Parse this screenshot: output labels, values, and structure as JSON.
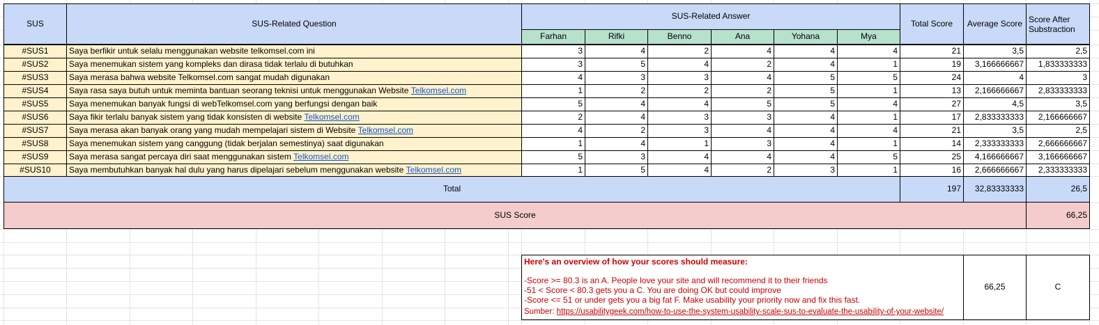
{
  "header": {
    "sus": "SUS",
    "question": "SUS-Related Question",
    "answer": "SUS-Related Answer",
    "total_score": "Total Score",
    "average_score": "Average Score",
    "after_sub": "Score After Substraction",
    "respondents": [
      "Farhan",
      "Rifki",
      "Benno",
      "Ana",
      "Yohana",
      "Mya"
    ]
  },
  "rows": [
    {
      "id": "#SUS1",
      "question": "Saya berfikir untuk selalu menggunakan website telkomsel.com ini",
      "link": "",
      "answers": [
        "3",
        "4",
        "2",
        "4",
        "4",
        "4"
      ],
      "total": "21",
      "avg": "3,5",
      "after": "2,5"
    },
    {
      "id": "#SUS2",
      "question": "Saya menemukan sistem yang kompleks dan dirasa tidak terlalu di butuhkan",
      "link": "",
      "answers": [
        "3",
        "5",
        "4",
        "2",
        "4",
        "1"
      ],
      "total": "19",
      "avg": "3,166666667",
      "after": "1,833333333"
    },
    {
      "id": "#SUS3",
      "question": "Saya merasa bahwa website Telkomsel.com sangat mudah digunakan",
      "link": "",
      "answers": [
        "4",
        "3",
        "3",
        "4",
        "5",
        "5"
      ],
      "total": "24",
      "avg": "4",
      "after": "3"
    },
    {
      "id": "#SUS4",
      "question": "Saya rasa saya butuh untuk meminta bantuan seorang teknisi untuk menggunakan Website ",
      "link": "Telkomsel.com",
      "answers": [
        "1",
        "2",
        "2",
        "2",
        "5",
        "1"
      ],
      "total": "13",
      "avg": "2,166666667",
      "after": "2,833333333"
    },
    {
      "id": "#SUS5",
      "question": "Saya menemukan banyak fungsi di webTelkomsel.com yang berfungsi dengan baik",
      "link": "",
      "answers": [
        "5",
        "4",
        "4",
        "5",
        "5",
        "4"
      ],
      "total": "27",
      "avg": "4,5",
      "after": "3,5"
    },
    {
      "id": "#SUS6",
      "question": "Saya fikir terlalu banyak sistem yang tidak konsisten di website ",
      "link": "Telkomsel.com",
      "answers": [
        "2",
        "4",
        "3",
        "3",
        "4",
        "1"
      ],
      "total": "17",
      "avg": "2,833333333",
      "after": "2,166666667"
    },
    {
      "id": "#SUS7",
      "question": "Saya merasa akan banyak orang yang mudah mempelajari sistem di Website ",
      "link": "Telkomsel.com",
      "answers": [
        "4",
        "2",
        "3",
        "4",
        "4",
        "4"
      ],
      "total": "21",
      "avg": "3,5",
      "after": "2,5"
    },
    {
      "id": "#SUS8",
      "question": "Saya menemukan sistem yang canggung (tidak berjalan semestinya) saat digunakan",
      "link": "",
      "answers": [
        "1",
        "4",
        "1",
        "3",
        "4",
        "1"
      ],
      "total": "14",
      "avg": "2,333333333",
      "after": "2,666666667"
    },
    {
      "id": "#SUS9",
      "question": "Saya merasa sangat percaya diri saat menggunakan sistem ",
      "link": "Telkomsel.com",
      "answers": [
        "5",
        "3",
        "4",
        "4",
        "4",
        "5"
      ],
      "total": "25",
      "avg": "4,166666667",
      "after": "3,166666667"
    },
    {
      "id": "#SUS10",
      "question": "Saya membutuhkan banyak hal dulu yang harus dipelajari sebelum menggunakan website ",
      "link": "Telkomsel.com",
      "answers": [
        "1",
        "5",
        "4",
        "2",
        "3",
        "1"
      ],
      "total": "16",
      "avg": "2,666666667",
      "after": "2,333333333"
    }
  ],
  "total_row": {
    "label": "Total",
    "total": "197",
    "avg": "32,83333333",
    "after": "26,5"
  },
  "sus_score_row": {
    "label": "SUS Score",
    "value": "66,25"
  },
  "note": {
    "title": "Here's an overview of how your scores should measure:",
    "lines": [
      "-Score >= 80.3 is an A. People love your site and will recommend it to their friends",
      "-51 < Score < 80.3  gets you a C. You are doing OK but could improve",
      "-Score <= 51 or under gets you a big fat F. Make usability your priority now and fix this fast."
    ],
    "source_label": "Sumber: ",
    "source_url": "https://usabilitygeek.com/how-to-use-the-system-usability-scale-sus-to-evaluate-the-usability-of-your-website/",
    "score": "66,25",
    "grade": "C"
  },
  "colors": {
    "header_blue": "#c9daf8",
    "respondent_green": "#b7e1cd",
    "row_yellow": "#fff2cc",
    "sus_pink": "#f4cccc",
    "note_red": "#cc0000",
    "link_blue": "#1155cc"
  }
}
